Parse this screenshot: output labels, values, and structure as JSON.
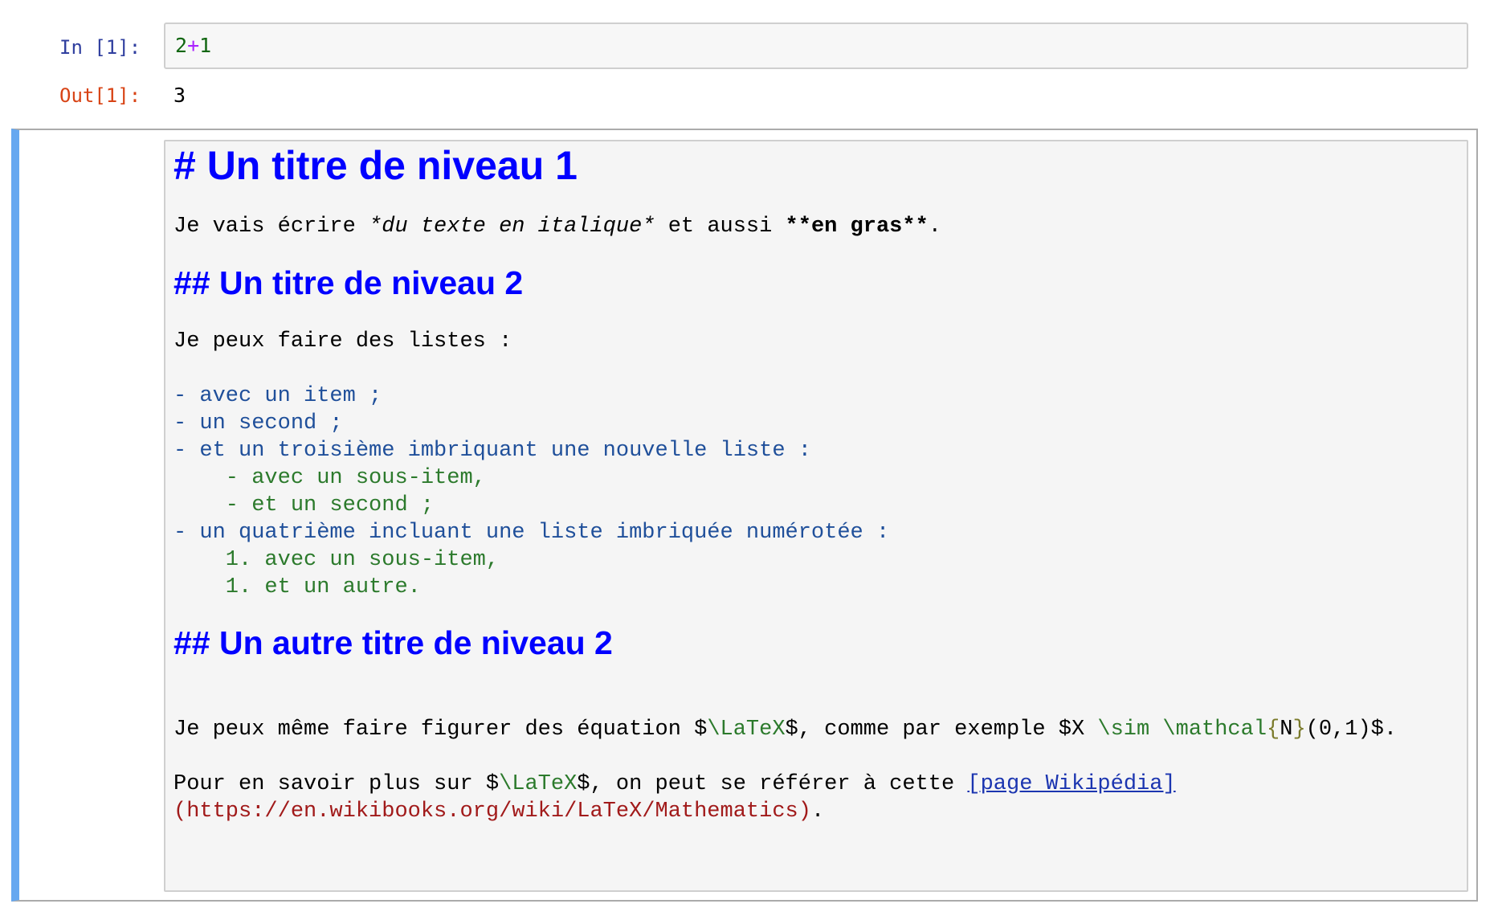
{
  "code_cell": {
    "in_prompt": "In [1]:",
    "out_prompt": "Out[1]:",
    "input": {
      "left": "2",
      "op": "+",
      "right": "1"
    },
    "output": "3"
  },
  "markdown_cell": {
    "h1": "# Un titre de niveau 1",
    "para1": {
      "a": "Je vais écrire ",
      "italic": "*du texte en italique*",
      "b": " et aussi ",
      "bold": "**en gras**",
      "c": "."
    },
    "h2_a": "## Un titre de niveau 2",
    "lists_intro": "Je peux faire des listes :",
    "list": [
      "- avec un item ;",
      "- un second ;",
      "- et un troisième imbriquant une nouvelle liste :",
      "    - avec un sous-item,",
      "    - et un second ;",
      "- un quatrième incluant une liste imbriquée numérotée :",
      "    1. avec un sous-item,",
      "    1. et un autre."
    ],
    "h2_b": "## Un autre titre de niveau 2",
    "eq_line": {
      "a": "Je peux même faire figurer des équation $",
      "latex": "\\LaTeX",
      "b": "$, comme par exemple $X ",
      "sim": "\\sim",
      "sp": " ",
      "mathcal": "\\mathcal",
      "lb": "{",
      "N": "N",
      "rb": "}",
      "c": "(0,1)$."
    },
    "ref_line1": {
      "a": "Pour en savoir plus sur $",
      "latex": "\\LaTeX",
      "b": "$, on peut se référer à cette ",
      "link": "[page Wikipédia]"
    },
    "ref_line2": {
      "url": "(https://en.wikibooks.org/wiki/LaTeX/Mathematics)",
      "end": "."
    }
  }
}
